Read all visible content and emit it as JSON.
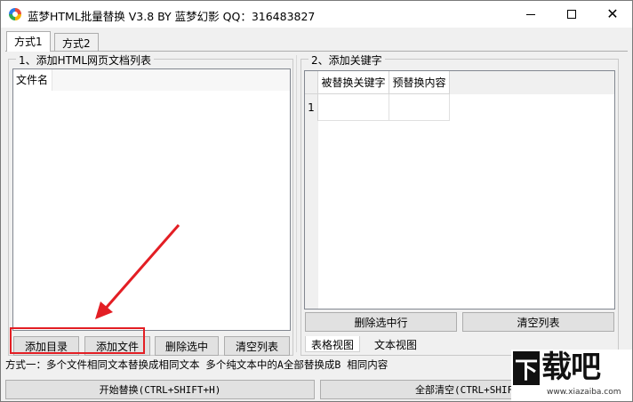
{
  "window": {
    "title": "蓝梦HTML批量替换 V3.8 BY 蓝梦幻影 QQ：316483827"
  },
  "tabs": [
    {
      "label": "方式1",
      "active": true
    },
    {
      "label": "方式2",
      "active": false
    }
  ],
  "left_group": {
    "legend": "1、添加HTML网页文档列表",
    "list_header": "文件名",
    "buttons": {
      "add_dir": "添加目录",
      "add_file": "添加文件",
      "delete_selected": "删除选中",
      "clear_list": "清空列表"
    }
  },
  "right_group": {
    "legend": "2、添加关键字",
    "grid_columns": [
      "被替换关键字",
      "预替换内容"
    ],
    "row_numbers": [
      "1"
    ],
    "buttons": {
      "delete_row": "删除选中行",
      "clear_list": "清空列表"
    },
    "view_tabs": [
      {
        "label": "表格视图",
        "active": true
      },
      {
        "label": "文本视图",
        "active": false
      }
    ]
  },
  "status_text": "方式一：多个文件相同文本替换成相同文本   多个纯文本中的A全部替换成B 相同内容",
  "bottom_buttons": {
    "start": "开始替换(CTRL+SHIFT+H)",
    "clear_all": "全部清空(CTRL+SHIFT+"
  },
  "watermark": {
    "badge": "下",
    "text": "载吧",
    "url": "www.xiazaiba.com"
  },
  "colors": {
    "highlight": "#e31e24",
    "window_bg": "#f0f0f0"
  }
}
